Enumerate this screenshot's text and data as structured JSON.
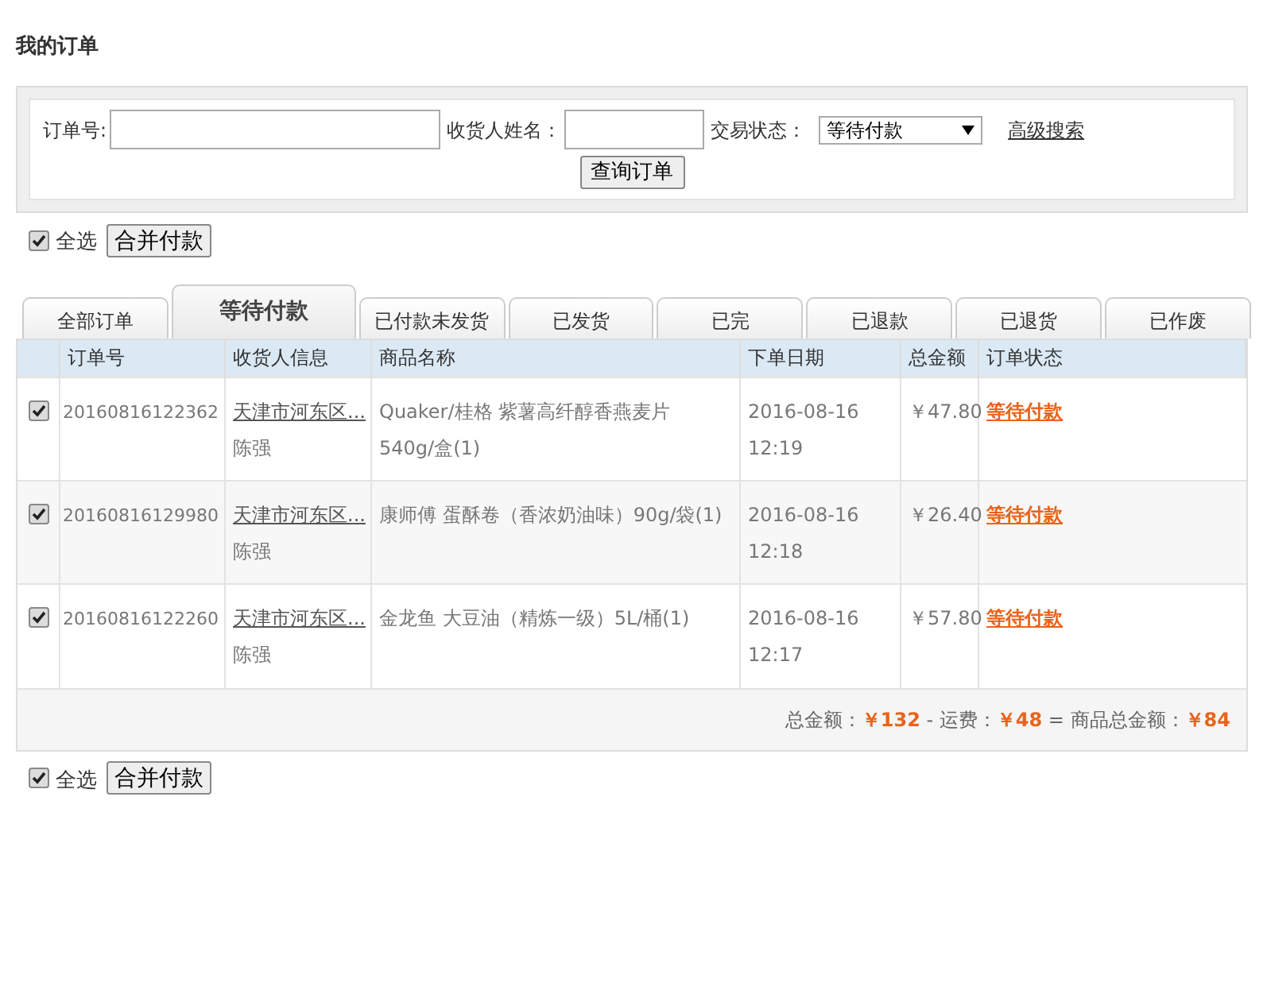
{
  "page_title": "我的订单",
  "search": {
    "order_no_label": "订单号:",
    "receiver_label": "收货人姓名：",
    "status_label": "交易状态：",
    "status_value": "等待付款",
    "advanced_link": "高级搜索",
    "submit": "查询订单"
  },
  "top_actions": {
    "select_all_label": "全选",
    "select_all_checked": true,
    "merge_button": "合并付款"
  },
  "tabs": [
    {
      "label": "全部订单",
      "selected": false
    },
    {
      "label": "等待付款",
      "selected": true
    },
    {
      "label": "已付款未发货",
      "selected": false
    },
    {
      "label": "已发货",
      "selected": false
    },
    {
      "label": "已完",
      "selected": false
    },
    {
      "label": "已退款",
      "selected": false
    },
    {
      "label": "已退货",
      "selected": false
    },
    {
      "label": "已作废",
      "selected": false
    }
  ],
  "table": {
    "columns": [
      "订单号",
      "收货人信息",
      "商品名称",
      "下单日期",
      "总金额",
      "订单状态"
    ],
    "rows": [
      {
        "checked": true,
        "order_no": "20160816122362",
        "address": "天津市河东区...",
        "receiver": "陈强",
        "product": "Quaker/桂格 紫薯高纤醇香燕麦片 540g/盒(1)",
        "date": "2016-08-16",
        "time": "12:19",
        "total": "￥47.80",
        "status": "等待付款"
      },
      {
        "checked": true,
        "order_no": "20160816129980",
        "address": "天津市河东区...",
        "receiver": "陈强",
        "product": "康师傅 蛋酥卷（香浓奶油味）90g/袋(1)",
        "date": "2016-08-16",
        "time": "12:18",
        "total": "￥26.40",
        "status": "等待付款"
      },
      {
        "checked": true,
        "order_no": "20160816122260",
        "address": "天津市河东区...",
        "receiver": "陈强",
        "product": "金龙鱼 大豆油（精炼一级）5L/桶(1)",
        "date": "2016-08-16",
        "time": "12:17",
        "total": "￥57.80",
        "status": "等待付款"
      }
    ],
    "summary": "总金额：**￥132** - 运费：**￥48** = 商品总金额：**￥84**"
  },
  "bottom_actions": {
    "select_all_label": "全选",
    "select_all_checked": true,
    "merge_button": "合并付款"
  }
}
